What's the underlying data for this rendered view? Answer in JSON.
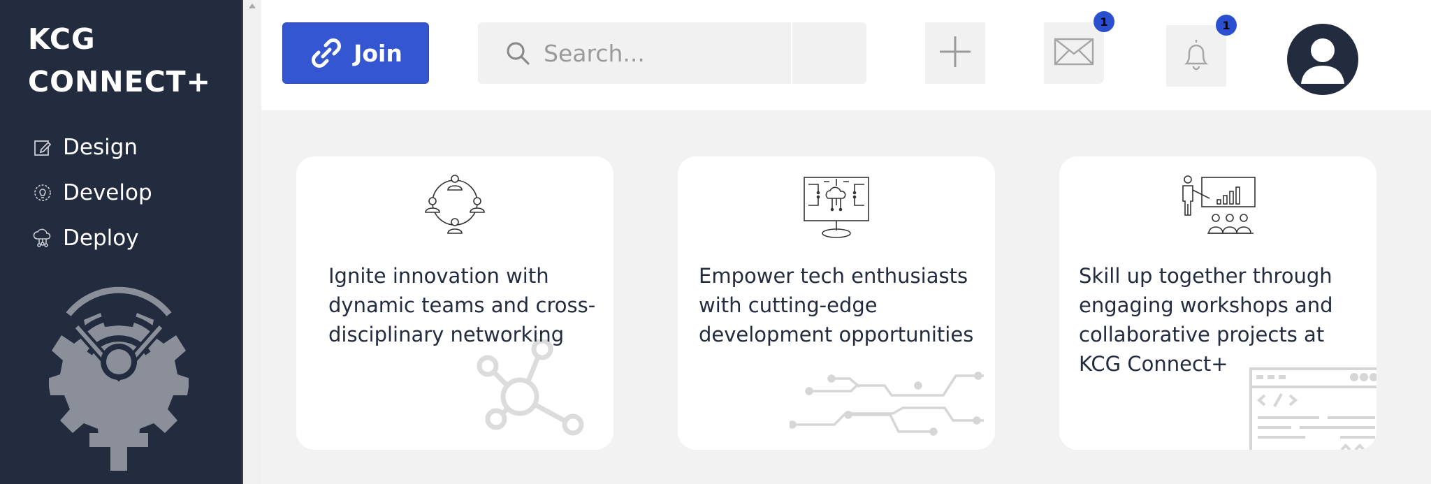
{
  "sidebar": {
    "brand_line1": "KCG",
    "brand_line2": "CONNECT+",
    "items": [
      {
        "label": "Design",
        "icon": "edit-icon"
      },
      {
        "label": "Develop",
        "icon": "bulb-gear-icon"
      },
      {
        "label": "Deploy",
        "icon": "cloud-network-icon"
      }
    ],
    "logo_icon": "gear-wifi-person-logo",
    "background": "#232b3f"
  },
  "topbar": {
    "join_label": "Join",
    "join_color": "#3556d1",
    "search_placeholder": "Search...",
    "messages_badge": "1",
    "notifications_badge": "1",
    "badge_color": "#2a50d1"
  },
  "cards": [
    {
      "text": "Ignite innovation with dynamic teams and cross-disciplinary networking",
      "icon": "team-network-icon",
      "decoration": "network-graph-icon"
    },
    {
      "text": "Empower tech enthusiasts with cutting-edge development opportunities",
      "icon": "cloud-monitor-icon",
      "decoration": "circuit-lines-icon"
    },
    {
      "text": "Skill up together through engaging workshops and collaborative projects at KCG Connect+",
      "icon": "presentation-audience-icon",
      "decoration": "code-window-icon"
    }
  ]
}
